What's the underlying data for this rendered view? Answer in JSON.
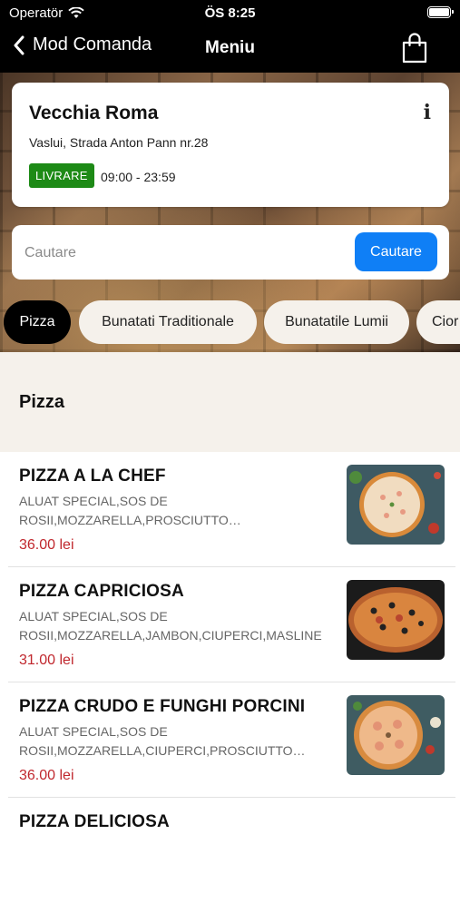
{
  "status_bar": {
    "carrier": "Operatör",
    "time": "ÖS 8:25"
  },
  "nav": {
    "back_label": "Mod Comanda",
    "title": "Meniu"
  },
  "restaurant": {
    "name": "Vecchia Roma",
    "address": "Vaslui, Strada Anton Pann nr.28",
    "badge": "LIVRARE",
    "hours": "09:00 - 23:59",
    "info_glyph": "i"
  },
  "search": {
    "placeholder": "Cautare",
    "button_label": "Cautare"
  },
  "categories": [
    {
      "label": "Pizza",
      "active": true
    },
    {
      "label": "Bunatati Traditionale",
      "active": false
    },
    {
      "label": "Bunatatile Lumii",
      "active": false
    },
    {
      "label": "Cior",
      "active": false
    }
  ],
  "section_title": "Pizza",
  "items": [
    {
      "name": "PIZZA A LA CHEF",
      "desc_line1": "ALUAT SPECIAL,SOS DE",
      "desc_line2": "ROSII,MOZZARELLA,PROSCIUTTO…",
      "price": "36.00 lei",
      "image": "pizza-a-la-chef-photo"
    },
    {
      "name": "PIZZA CAPRICIOSA",
      "desc_line1": "ALUAT SPECIAL,SOS DE",
      "desc_line2": "ROSII,MOZZARELLA,JAMBON,CIUPERCI,MASLINE",
      "price": "31.00 lei",
      "image": "pizza-capriciosa-photo"
    },
    {
      "name": "PIZZA CRUDO E FUNGHI PORCINI",
      "desc_line1": "ALUAT SPECIAL,SOS DE",
      "desc_line2": "ROSII,MOZZARELLA,CIUPERCI,PROSCIUTTO…",
      "price": "36.00 lei",
      "image": "pizza-crudo-e-funghi-porcini-photo"
    },
    {
      "name": "PIZZA DELICIOSA",
      "desc_line1": "",
      "desc_line2": "",
      "price": "",
      "image": ""
    }
  ],
  "colors": {
    "accent": "#0f7ff6",
    "badge": "#1d8a16",
    "price": "#c0272d",
    "section_bg": "#f5f1eb"
  }
}
